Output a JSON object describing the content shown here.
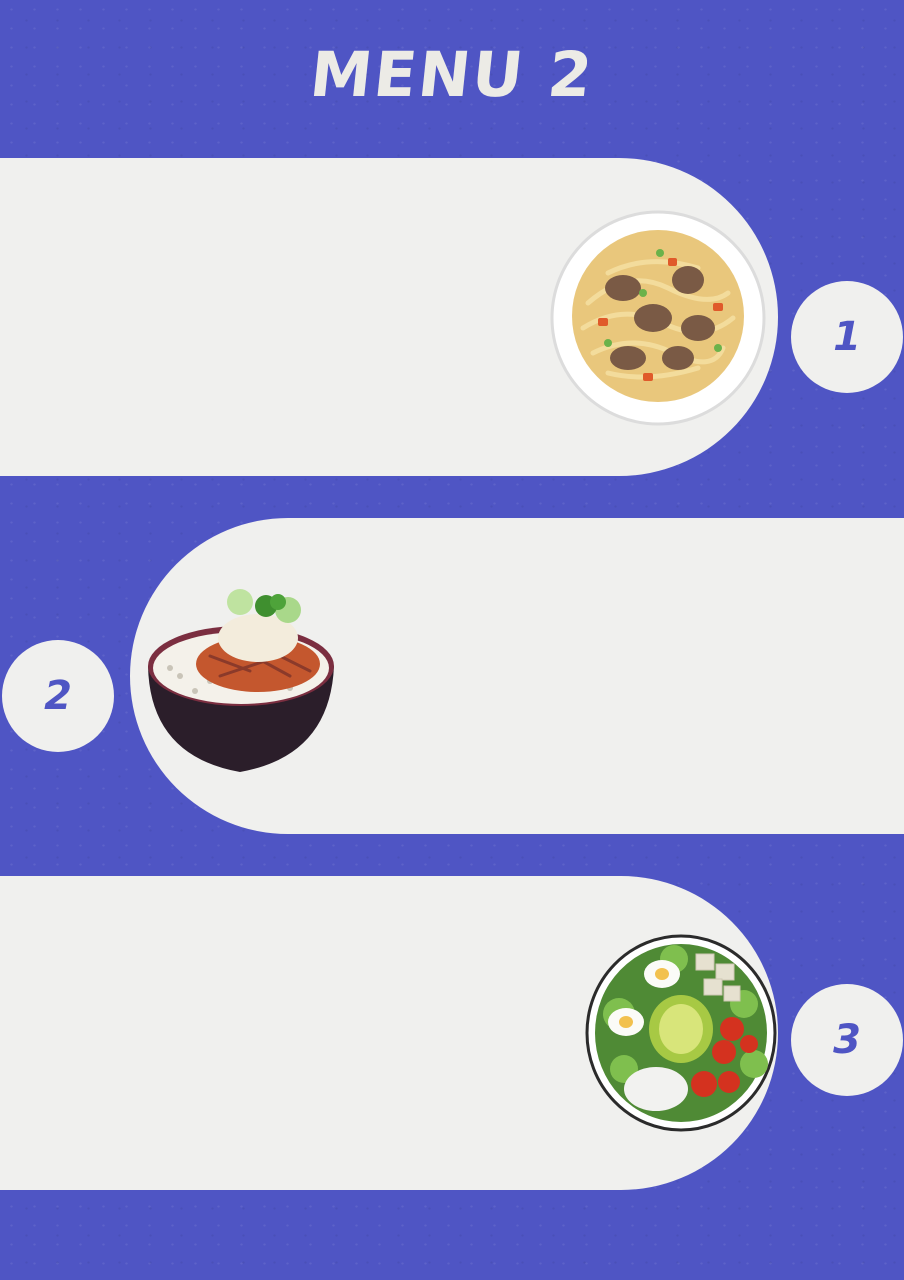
{
  "header": {
    "title": "MENU 2"
  },
  "items": [
    {
      "number": "1",
      "dish_icon": "noodle-soup-bowl-icon"
    },
    {
      "number": "2",
      "dish_icon": "rice-bowl-icon"
    },
    {
      "number": "3",
      "dish_icon": "salad-bowl-icon"
    }
  ],
  "colors": {
    "background": "#4f55c4",
    "panel": "#f0f0ee",
    "accent": "#4f55c4"
  }
}
